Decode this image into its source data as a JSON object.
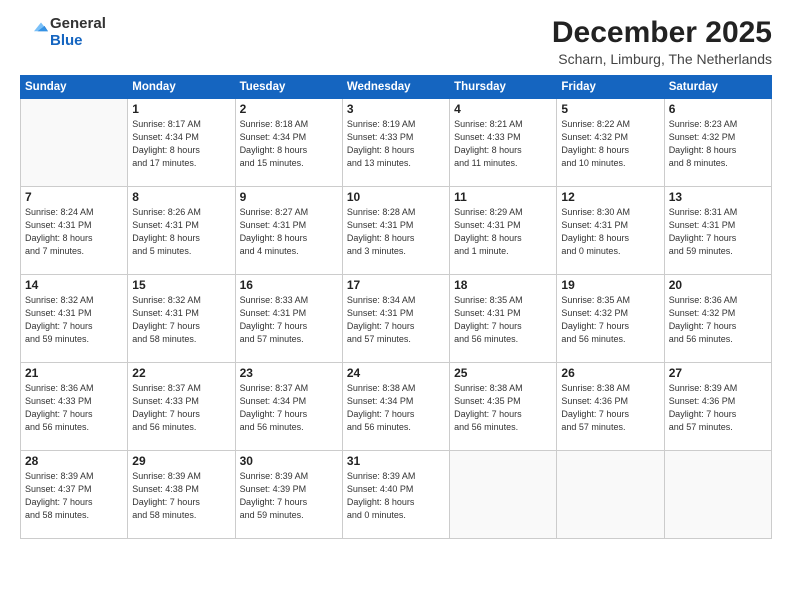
{
  "logo": {
    "general": "General",
    "blue": "Blue"
  },
  "header": {
    "month": "December 2025",
    "location": "Scharn, Limburg, The Netherlands"
  },
  "days_of_week": [
    "Sunday",
    "Monday",
    "Tuesday",
    "Wednesday",
    "Thursday",
    "Friday",
    "Saturday"
  ],
  "weeks": [
    [
      {
        "day": "",
        "info": ""
      },
      {
        "day": "1",
        "info": "Sunrise: 8:17 AM\nSunset: 4:34 PM\nDaylight: 8 hours\nand 17 minutes."
      },
      {
        "day": "2",
        "info": "Sunrise: 8:18 AM\nSunset: 4:34 PM\nDaylight: 8 hours\nand 15 minutes."
      },
      {
        "day": "3",
        "info": "Sunrise: 8:19 AM\nSunset: 4:33 PM\nDaylight: 8 hours\nand 13 minutes."
      },
      {
        "day": "4",
        "info": "Sunrise: 8:21 AM\nSunset: 4:33 PM\nDaylight: 8 hours\nand 11 minutes."
      },
      {
        "day": "5",
        "info": "Sunrise: 8:22 AM\nSunset: 4:32 PM\nDaylight: 8 hours\nand 10 minutes."
      },
      {
        "day": "6",
        "info": "Sunrise: 8:23 AM\nSunset: 4:32 PM\nDaylight: 8 hours\nand 8 minutes."
      }
    ],
    [
      {
        "day": "7",
        "info": "Sunrise: 8:24 AM\nSunset: 4:31 PM\nDaylight: 8 hours\nand 7 minutes."
      },
      {
        "day": "8",
        "info": "Sunrise: 8:26 AM\nSunset: 4:31 PM\nDaylight: 8 hours\nand 5 minutes."
      },
      {
        "day": "9",
        "info": "Sunrise: 8:27 AM\nSunset: 4:31 PM\nDaylight: 8 hours\nand 4 minutes."
      },
      {
        "day": "10",
        "info": "Sunrise: 8:28 AM\nSunset: 4:31 PM\nDaylight: 8 hours\nand 3 minutes."
      },
      {
        "day": "11",
        "info": "Sunrise: 8:29 AM\nSunset: 4:31 PM\nDaylight: 8 hours\nand 1 minute."
      },
      {
        "day": "12",
        "info": "Sunrise: 8:30 AM\nSunset: 4:31 PM\nDaylight: 8 hours\nand 0 minutes."
      },
      {
        "day": "13",
        "info": "Sunrise: 8:31 AM\nSunset: 4:31 PM\nDaylight: 7 hours\nand 59 minutes."
      }
    ],
    [
      {
        "day": "14",
        "info": "Sunrise: 8:32 AM\nSunset: 4:31 PM\nDaylight: 7 hours\nand 59 minutes."
      },
      {
        "day": "15",
        "info": "Sunrise: 8:32 AM\nSunset: 4:31 PM\nDaylight: 7 hours\nand 58 minutes."
      },
      {
        "day": "16",
        "info": "Sunrise: 8:33 AM\nSunset: 4:31 PM\nDaylight: 7 hours\nand 57 minutes."
      },
      {
        "day": "17",
        "info": "Sunrise: 8:34 AM\nSunset: 4:31 PM\nDaylight: 7 hours\nand 57 minutes."
      },
      {
        "day": "18",
        "info": "Sunrise: 8:35 AM\nSunset: 4:31 PM\nDaylight: 7 hours\nand 56 minutes."
      },
      {
        "day": "19",
        "info": "Sunrise: 8:35 AM\nSunset: 4:32 PM\nDaylight: 7 hours\nand 56 minutes."
      },
      {
        "day": "20",
        "info": "Sunrise: 8:36 AM\nSunset: 4:32 PM\nDaylight: 7 hours\nand 56 minutes."
      }
    ],
    [
      {
        "day": "21",
        "info": "Sunrise: 8:36 AM\nSunset: 4:33 PM\nDaylight: 7 hours\nand 56 minutes."
      },
      {
        "day": "22",
        "info": "Sunrise: 8:37 AM\nSunset: 4:33 PM\nDaylight: 7 hours\nand 56 minutes."
      },
      {
        "day": "23",
        "info": "Sunrise: 8:37 AM\nSunset: 4:34 PM\nDaylight: 7 hours\nand 56 minutes."
      },
      {
        "day": "24",
        "info": "Sunrise: 8:38 AM\nSunset: 4:34 PM\nDaylight: 7 hours\nand 56 minutes."
      },
      {
        "day": "25",
        "info": "Sunrise: 8:38 AM\nSunset: 4:35 PM\nDaylight: 7 hours\nand 56 minutes."
      },
      {
        "day": "26",
        "info": "Sunrise: 8:38 AM\nSunset: 4:36 PM\nDaylight: 7 hours\nand 57 minutes."
      },
      {
        "day": "27",
        "info": "Sunrise: 8:39 AM\nSunset: 4:36 PM\nDaylight: 7 hours\nand 57 minutes."
      }
    ],
    [
      {
        "day": "28",
        "info": "Sunrise: 8:39 AM\nSunset: 4:37 PM\nDaylight: 7 hours\nand 58 minutes."
      },
      {
        "day": "29",
        "info": "Sunrise: 8:39 AM\nSunset: 4:38 PM\nDaylight: 7 hours\nand 58 minutes."
      },
      {
        "day": "30",
        "info": "Sunrise: 8:39 AM\nSunset: 4:39 PM\nDaylight: 7 hours\nand 59 minutes."
      },
      {
        "day": "31",
        "info": "Sunrise: 8:39 AM\nSunset: 4:40 PM\nDaylight: 8 hours\nand 0 minutes."
      },
      {
        "day": "",
        "info": ""
      },
      {
        "day": "",
        "info": ""
      },
      {
        "day": "",
        "info": ""
      }
    ]
  ]
}
